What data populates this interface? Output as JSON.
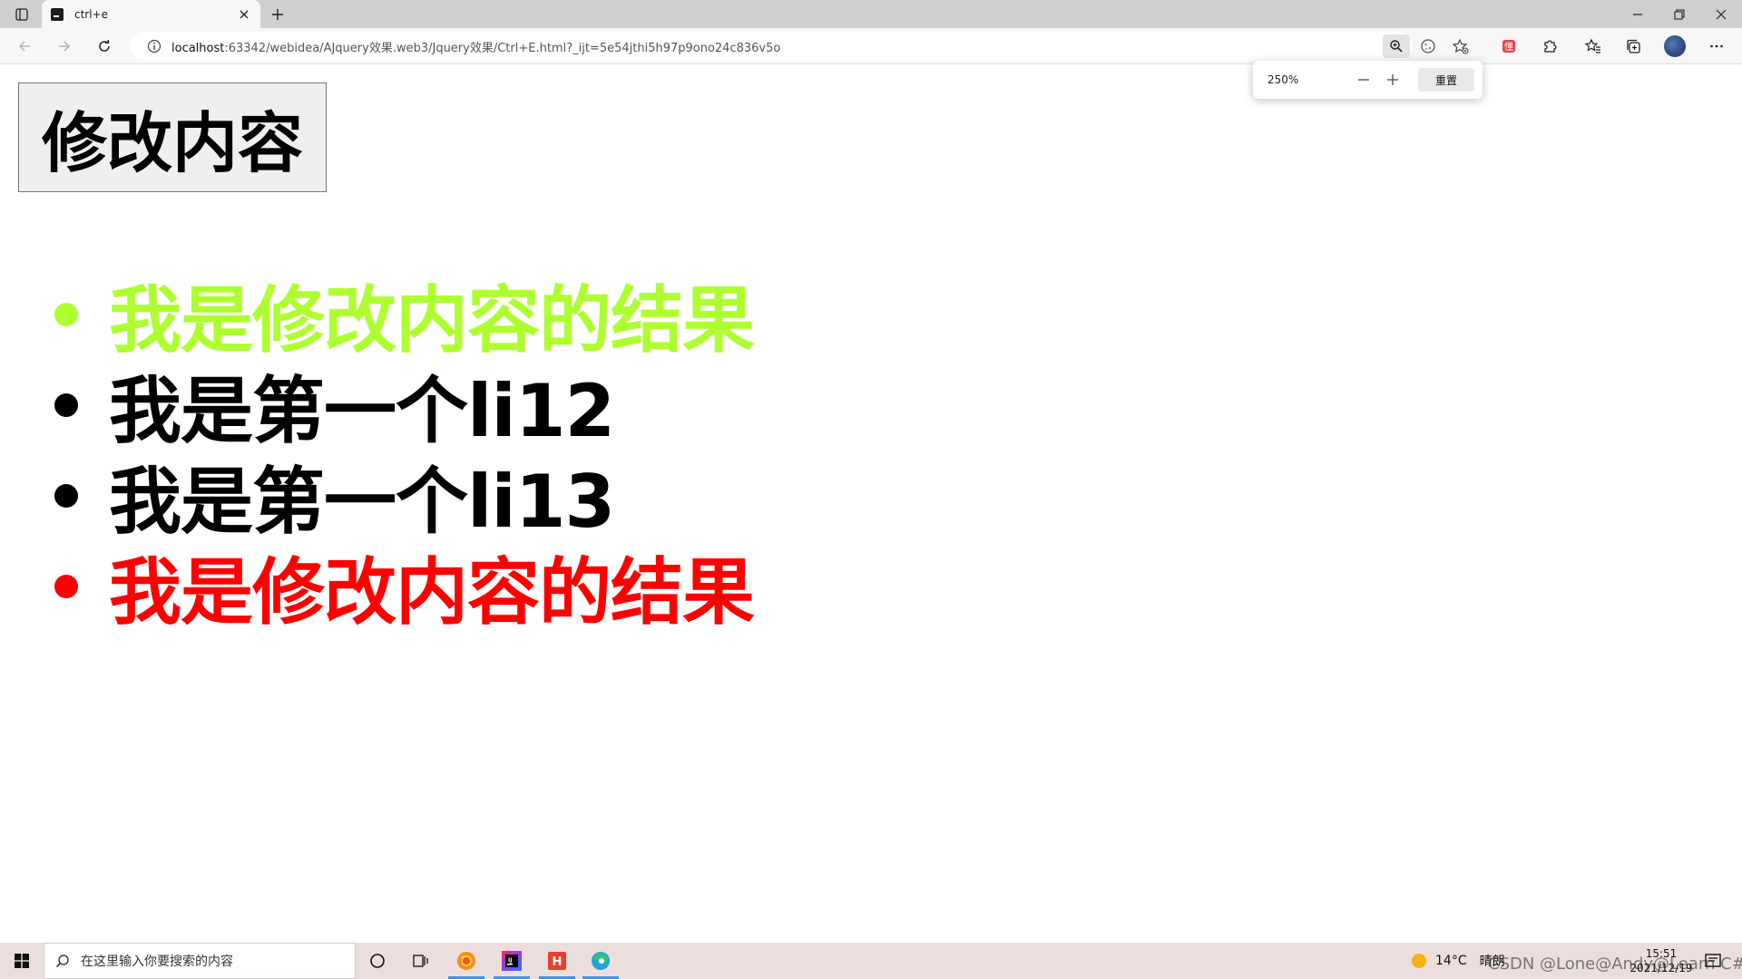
{
  "browser": {
    "tab_title": "ctrl+e",
    "url_host": "localhost",
    "url_rest": ":63342/webidea/AJquery效果.web3/Jquery效果/Ctrl+E.html?_ijt=5e54jthi5h97p9ono24c836v5o",
    "zoom_level": "250%",
    "zoom_reset_label": "重置"
  },
  "page": {
    "button_label": "修改内容",
    "items": [
      {
        "text": "我是修改内容的结果",
        "color": "#adff2f"
      },
      {
        "text": "我是第一个li12",
        "color": "#000000"
      },
      {
        "text": "我是第一个li13",
        "color": "#000000"
      },
      {
        "text": "我是修改内容的结果",
        "color": "#ff0000"
      }
    ]
  },
  "taskbar": {
    "search_placeholder": "在这里输入你要搜索的内容",
    "temperature": "14°C",
    "weather": "晴朗",
    "time": "15:51",
    "date": "2021/12/19",
    "watermark": "CSDN @Lone@Andy@Learn C#"
  },
  "icons": {
    "tab_actions": "tab-actions-icon",
    "zoom": "zoom-icon",
    "tracking": "tracking-prevention-icon",
    "favorite": "add-favorite-icon",
    "extension_red": "extension-icon",
    "extensions": "puzzle-icon",
    "favorites": "favorites-icon",
    "collections": "collections-icon",
    "more": "more-icon"
  }
}
